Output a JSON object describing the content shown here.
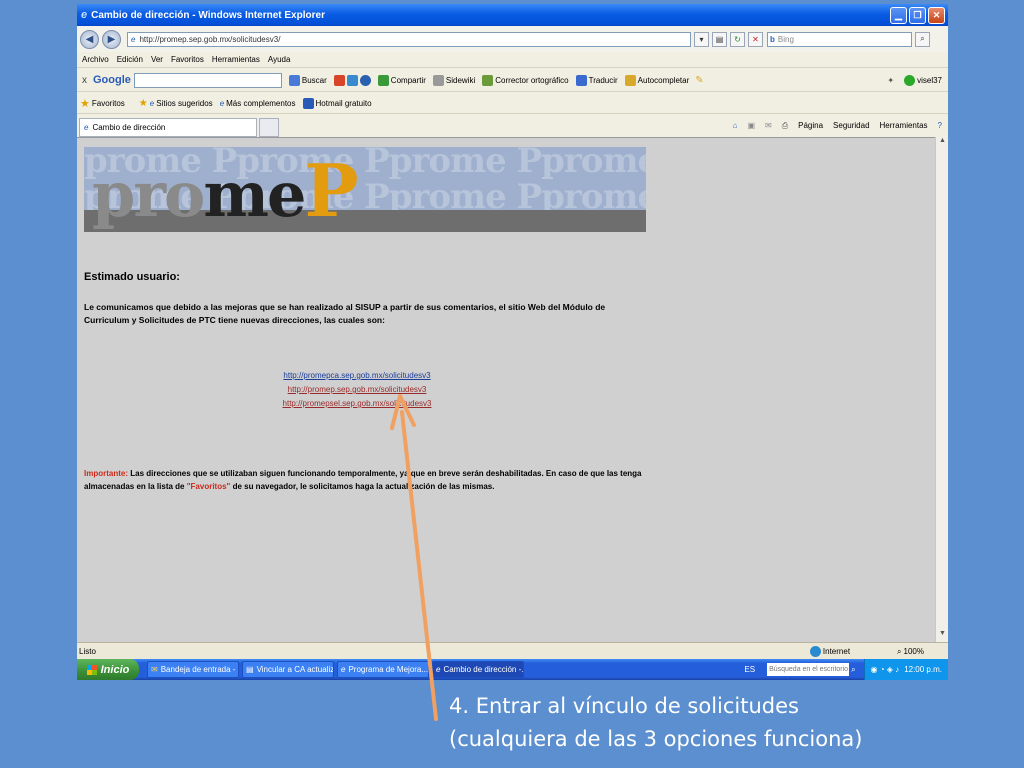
{
  "window": {
    "title": "Cambio de dirección - Windows Internet Explorer",
    "min_glyph": "▁",
    "max_glyph": "❐",
    "close_glyph": "✕"
  },
  "address_bar": {
    "url": "http://promep.sep.gob.mx/solicitudesv3/",
    "search_engine": "Bing"
  },
  "menu": [
    "Archivo",
    "Edición",
    "Ver",
    "Favoritos",
    "Herramientas",
    "Ayuda"
  ],
  "google_toolbar": {
    "close_glyph": "x",
    "brand": "Google",
    "search_label": "Buscar",
    "items": [
      "Compartir",
      "Sidewiki",
      "Corrector ortográfico",
      "Traducir",
      "Autocompletar"
    ],
    "user": "visel37"
  },
  "favorites_bar": {
    "favorites_label": "Favoritos",
    "items": [
      "Sitios sugeridos",
      "Más complementos",
      "Hotmail gratuito"
    ]
  },
  "tab": {
    "label": "Cambio de dirección",
    "commands": [
      "Página",
      "Seguridad",
      "Herramientas"
    ]
  },
  "page": {
    "banner_text": "promeP",
    "greeting": "Estimado usuario:",
    "intro": "Le comunicamos que debido a las mejoras que se han realizado al SISUP a partir de sus comentarios, el sitio Web del Módulo de Curriculum y Solicitudes de PTC tiene nuevas direcciones, las cuales son:",
    "links": [
      "http://promepca.sep.gob.mx/solicitudesv3",
      "http://promep.sep.gob.mx/solicitudesv3",
      "http://promepsel.sep.gob.mx/solicitudesv3"
    ],
    "notice_label": "Importante:",
    "notice_part1": "Las direcciones que se utilizaban siguen funcionando temporalmente, ya que en breve serán deshabilitadas. En caso de que las tenga almacenadas en la lista de",
    "notice_fav": "\"Favoritos\"",
    "notice_part2": "de su navegador, le solicitamos haga la actualización de las mismas."
  },
  "status_bar": {
    "status": "Listo",
    "zone": "Internet",
    "zoom": "100%"
  },
  "taskbar": {
    "start": "Inicio",
    "tasks": [
      "Bandeja de entrada - ...",
      "Vincular a CA actualiz...",
      "Programa de Mejora...",
      "Cambio de dirección -..."
    ],
    "lang": "ES",
    "search_placeholder": "Búsqueda en el escritorio",
    "clock": "12:00 p.m."
  },
  "caption": {
    "line1": "4. Entrar al vínculo de solicitudes",
    "line2": "(cualquiera de las 3 opciones funciona)"
  },
  "colors": {
    "slide_background": "#5b8fd0",
    "arrow": "#f0a060",
    "logo_orange": "#e39b10",
    "notice_red": "#cc2a1a"
  }
}
